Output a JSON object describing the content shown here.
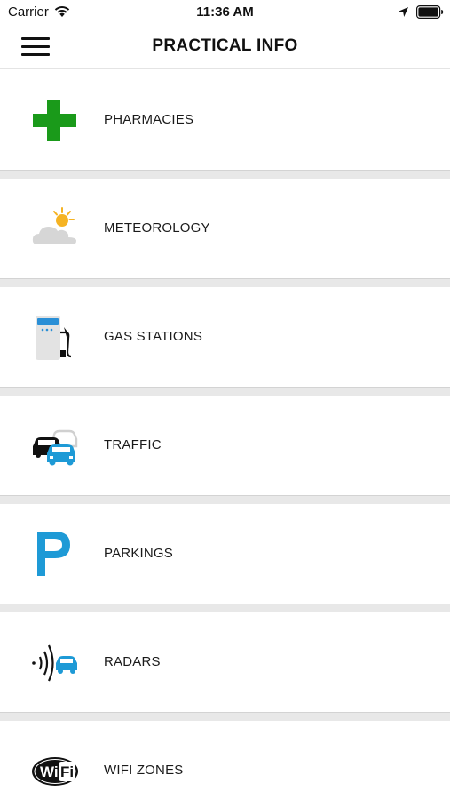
{
  "status_bar": {
    "carrier": "Carrier",
    "time": "11:36 AM"
  },
  "header": {
    "title": "PRACTICAL INFO"
  },
  "items": [
    {
      "label": "PHARMACIES",
      "icon": "pharmacy-cross-icon",
      "color": "#1a9a1a"
    },
    {
      "label": "METEOROLOGY",
      "icon": "weather-sun-cloud-icon",
      "color": "#f5b323"
    },
    {
      "label": "GAS STATIONS",
      "icon": "gas-pump-icon",
      "color": "#2a8fd6"
    },
    {
      "label": "TRAFFIC",
      "icon": "traffic-cars-icon",
      "color": "#1e9ad6"
    },
    {
      "label": "PARKINGS",
      "icon": "parking-p-icon",
      "color": "#1e9ad6"
    },
    {
      "label": "RADARS",
      "icon": "radar-car-icon",
      "color": "#1e9ad6"
    },
    {
      "label": "WIFI ZONES",
      "icon": "wifi-badge-icon",
      "color": "#111111"
    }
  ]
}
